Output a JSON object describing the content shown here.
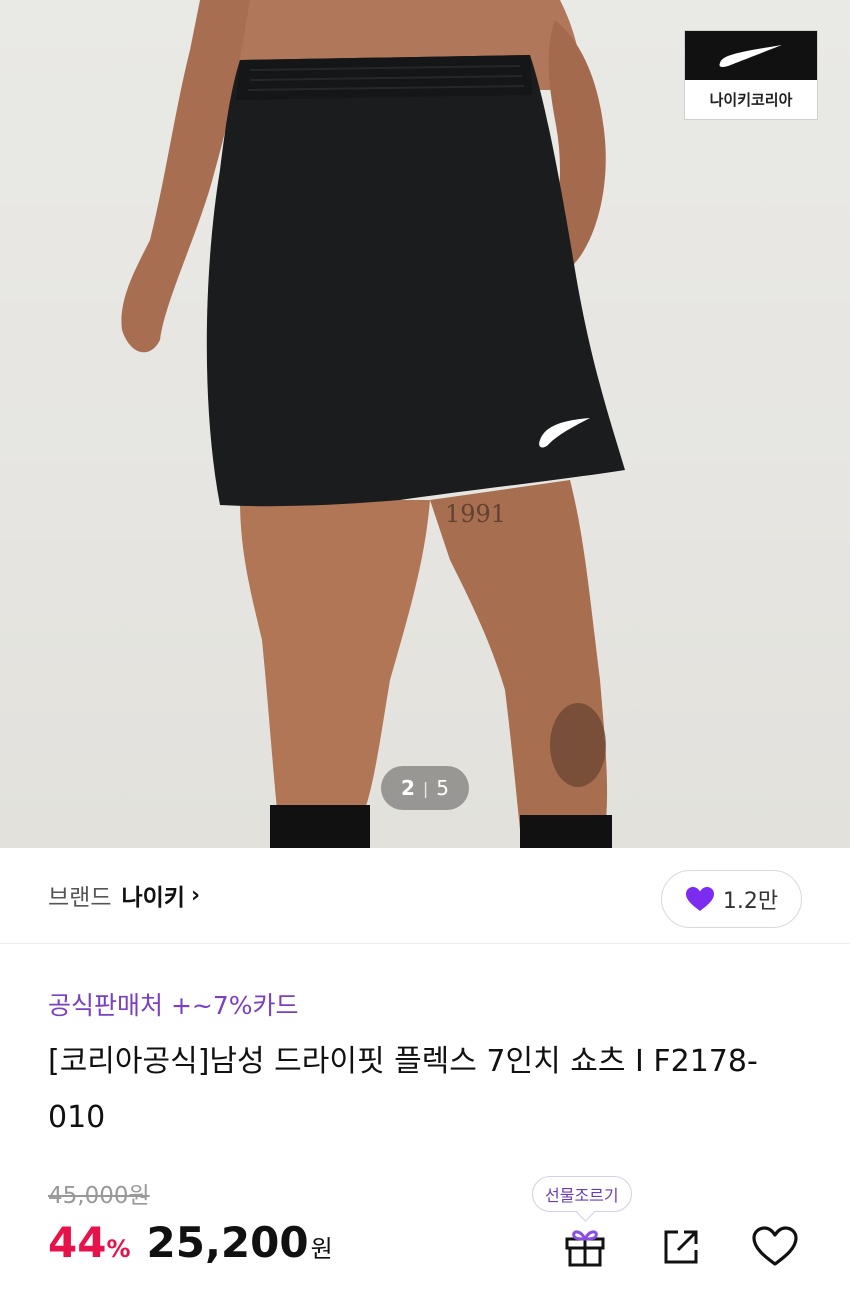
{
  "hero": {
    "brand_badge_text": "나이키코리아",
    "image_counter": {
      "current": "2",
      "separator": "|",
      "total": "5"
    },
    "tattoo_text": "1991"
  },
  "brand_row": {
    "label": "브랜드",
    "brand_name": "나이키",
    "chevron": "›",
    "like_count": "1.2만",
    "heart_color": "#7b2cf0"
  },
  "product": {
    "promo": "공식판매처 +~7%카드",
    "title": "[코리아공식]남성 드라이핏 플렉스 7인치 쇼츠 I F2178-010",
    "original_price": "45,000원",
    "discount_value": "44",
    "discount_unit": "%",
    "price": "25,200",
    "currency": "원"
  },
  "actions": {
    "gift_tooltip": "선물조르기",
    "gift_icon": "gift-icon",
    "share_icon": "share-icon",
    "wishlist_icon": "heart-outline-icon"
  },
  "colors": {
    "accent_purple": "#7a3fc5",
    "discount_red": "#e8124a"
  }
}
